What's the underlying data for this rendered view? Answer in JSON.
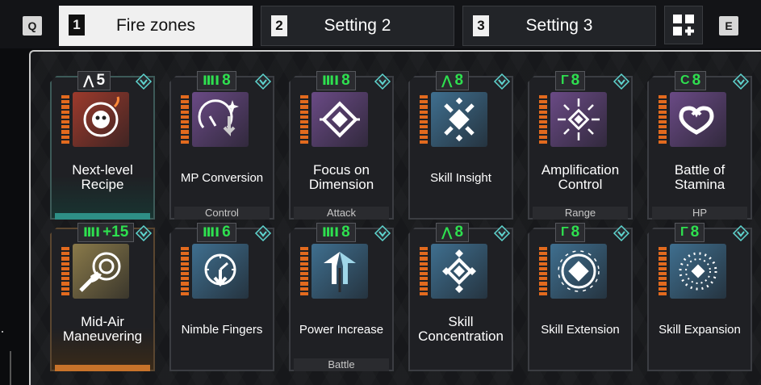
{
  "hotkeys": {
    "prev": "Q",
    "next": "E"
  },
  "tabs": [
    {
      "num": "1",
      "label": "Fire zones",
      "active": true
    },
    {
      "num": "2",
      "label": "Setting 2",
      "active": false
    },
    {
      "num": "3",
      "label": "Setting 3",
      "active": false
    }
  ],
  "add_icon": "add-settings-icon",
  "colors": {
    "green": "#2ee04f",
    "orange": "#e26a1e",
    "teal": "#2e8f86",
    "cyan": "#5ed6d0"
  },
  "cards": [
    {
      "name": "Next-level Recipe",
      "category": "",
      "cost_symbol": "⋀",
      "cost": "5",
      "cost_color": "#ffffff",
      "icon": "chef-skull-icon",
      "tint": "#9c3a2c"
    },
    {
      "name": "MP Conversion",
      "category": "Control",
      "cost_symbol": "ⅢⅠ",
      "cost": "8",
      "cost_color": "#2ee04f",
      "icon": "gauge-down-icon",
      "tint": "#6a4a85"
    },
    {
      "name": "Focus on Dimension",
      "category": "Attack",
      "cost_symbol": "ⅢⅠ",
      "cost": "8",
      "cost_color": "#2ee04f",
      "icon": "diamond-weave-icon",
      "tint": "#6a4a85"
    },
    {
      "name": "Skill Insight",
      "category": "",
      "cost_symbol": "⋀",
      "cost": "8",
      "cost_color": "#2ee04f",
      "icon": "diamond-burst-icon",
      "tint": "#3f6f8f"
    },
    {
      "name": "Amplification Control",
      "category": "Range",
      "cost_symbol": "Γ",
      "cost": "8",
      "cost_color": "#2ee04f",
      "icon": "diamond-rays-icon",
      "tint": "#6a4a85"
    },
    {
      "name": "Battle of Stamina",
      "category": "HP",
      "cost_symbol": "C",
      "cost": "8",
      "cost_color": "#2ee04f",
      "icon": "double-heart-icon",
      "tint": "#6a4a85"
    },
    {
      "name": "Mid-Air Maneuvering",
      "category": "",
      "cost_symbol": "ⅢⅠ",
      "cost": "+15",
      "cost_color": "#2ee04f",
      "icon": "target-hand-icon",
      "tint": "#8a7a4a"
    },
    {
      "name": "Nimble Fingers",
      "category": "",
      "cost_symbol": "ⅢⅠ",
      "cost": "6",
      "cost_color": "#2ee04f",
      "icon": "gauge-arrow-icon",
      "tint": "#3f6f8f"
    },
    {
      "name": "Power Increase",
      "category": "Battle",
      "cost_symbol": "ⅢⅠ",
      "cost": "8",
      "cost_color": "#2ee04f",
      "icon": "arrow-up-icon",
      "tint": "#3f6f8f"
    },
    {
      "name": "Skill Concentration",
      "category": "",
      "cost_symbol": "⋀",
      "cost": "8",
      "cost_color": "#2ee04f",
      "icon": "diamond-stack-icon",
      "tint": "#3f6f8f"
    },
    {
      "name": "Skill Extension",
      "category": "",
      "cost_symbol": "Γ",
      "cost": "8",
      "cost_color": "#2ee04f",
      "icon": "diamond-circle-icon",
      "tint": "#3f6f8f"
    },
    {
      "name": "Skill Expansion",
      "category": "",
      "cost_symbol": "Γ",
      "cost": "8",
      "cost_color": "#2ee04f",
      "icon": "dotted-circle-icon",
      "tint": "#3f6f8f"
    }
  ]
}
